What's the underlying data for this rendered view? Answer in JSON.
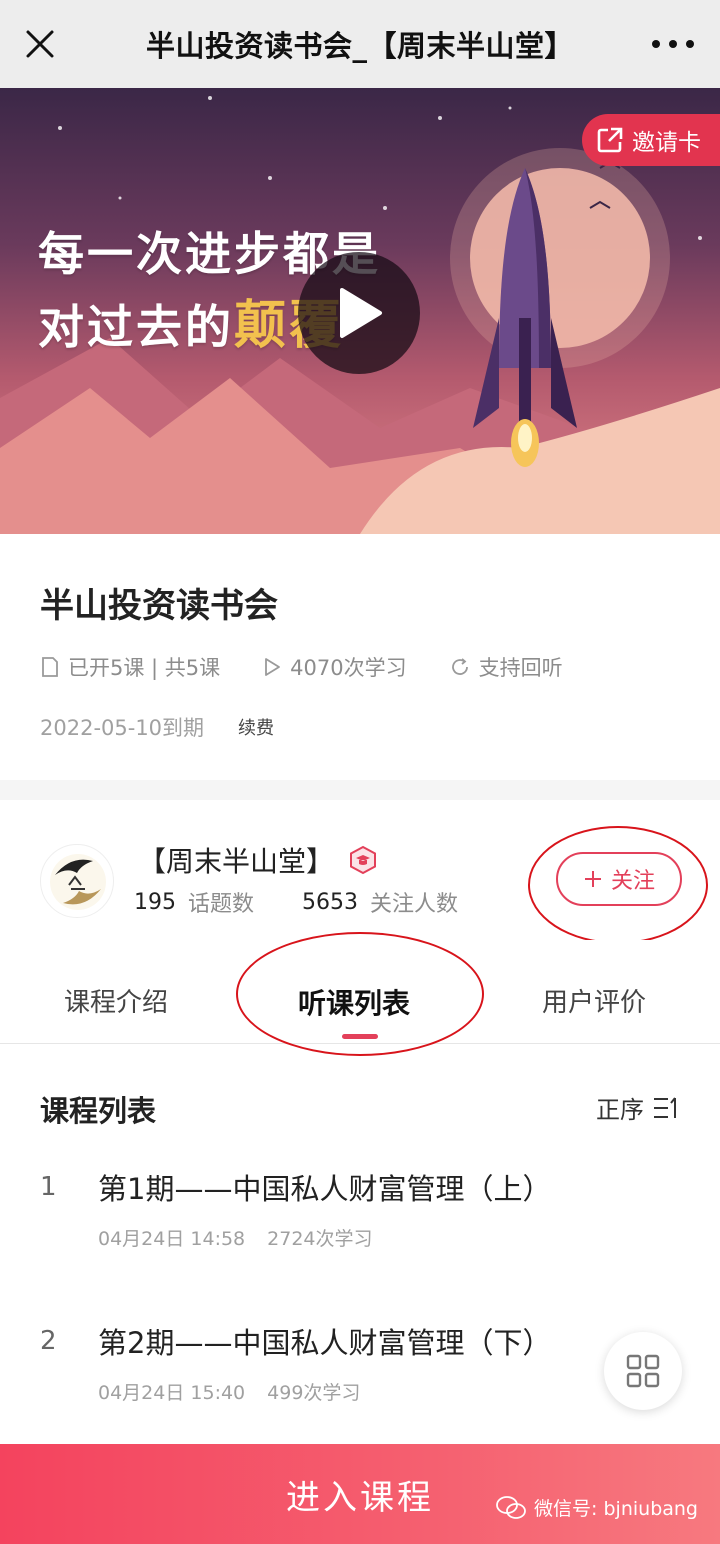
{
  "topbar": {
    "title": "半山投资读书会_【周末半山堂】"
  },
  "banner": {
    "headline_line1": "每一次进步都是",
    "headline_line2_prefix": "对过去的",
    "headline_line2_highlight": "颠覆",
    "invite_label": "邀请卡"
  },
  "course": {
    "title": "半山投资读书会",
    "lessons_status": "已开5课 | 共5课",
    "study_count": "4070次学习",
    "replay": "支持回听",
    "expire": "2022-05-10到期",
    "renew_label": "续费"
  },
  "author": {
    "name": "【周末半山堂】",
    "topics_count": "195",
    "topics_label": "话题数",
    "followers_count": "5653",
    "followers_label": "关注人数",
    "follow_label": "关注"
  },
  "tabs": [
    {
      "label": "课程介绍"
    },
    {
      "label": "听课列表"
    },
    {
      "label": "用户评价"
    }
  ],
  "list": {
    "heading": "课程列表",
    "order_label": "正序",
    "items": [
      {
        "num": "1",
        "title": "第1期——中国私人财富管理（上）",
        "time": "04月24日 14:58",
        "count": "2724次学习"
      },
      {
        "num": "2",
        "title": "第2期——中国私人财富管理（下）",
        "time": "04月24日 15:40",
        "count": "499次学习"
      }
    ]
  },
  "bottom": {
    "enter_label": "进入课程",
    "watermark": "微信号: bjniubang"
  },
  "colors": {
    "accent": "#e3405a",
    "annotation": "#d8141b",
    "banner_highlight": "#f2c14e"
  }
}
